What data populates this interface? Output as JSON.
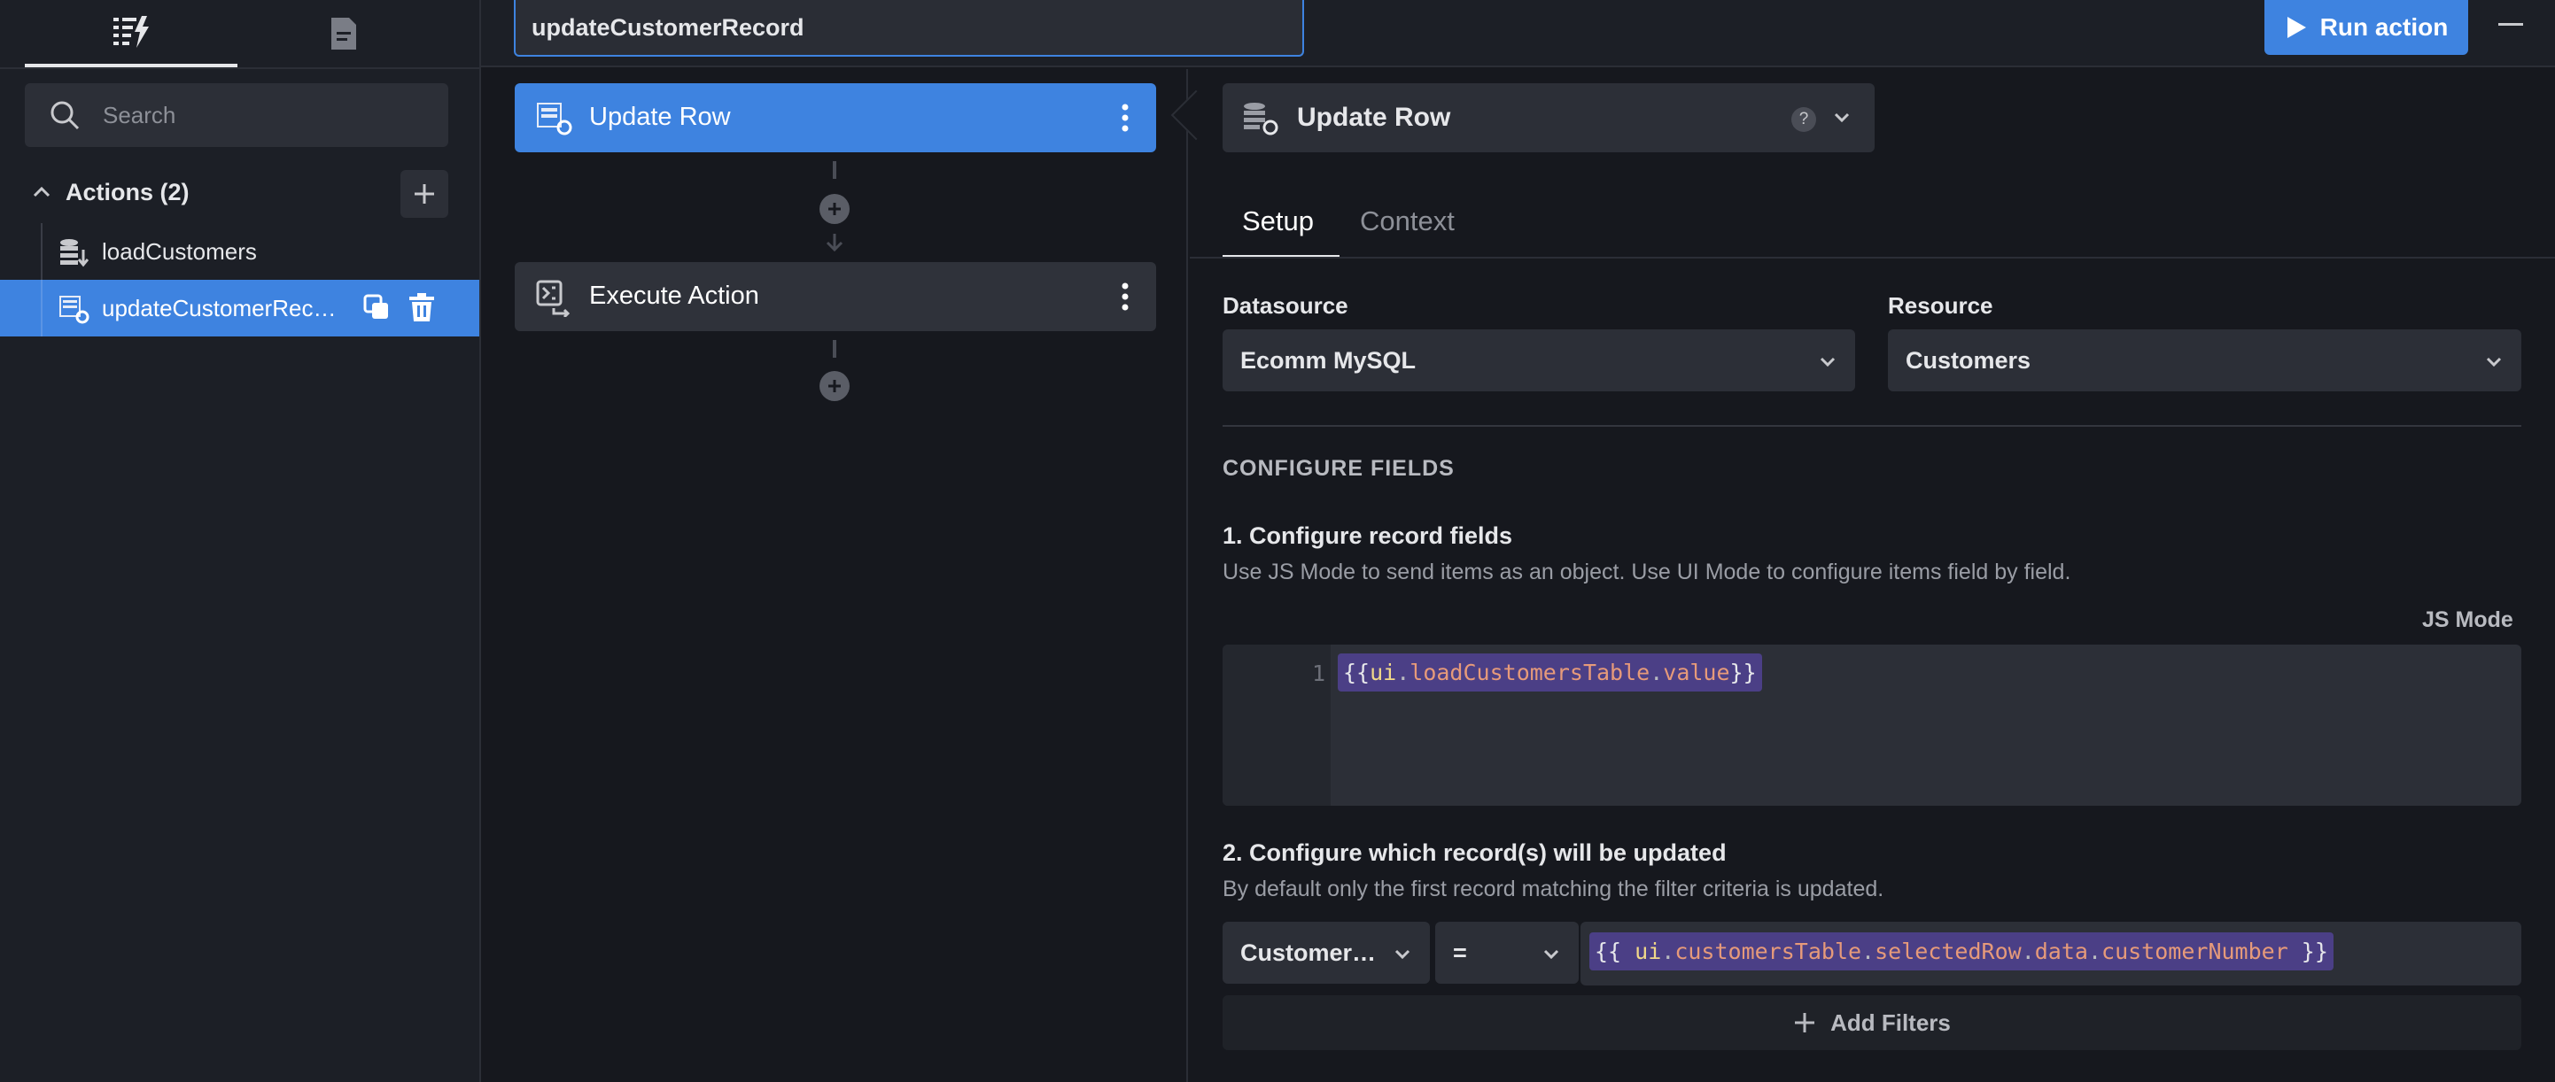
{
  "sidebar": {
    "tabs": [
      {
        "icon": "actions-lightning-icon"
      },
      {
        "icon": "document-icon"
      }
    ],
    "search_placeholder": "Search",
    "actions_header": "Actions (2)",
    "actions": [
      {
        "label": "loadCustomers",
        "icon": "database-load-icon"
      },
      {
        "label": "updateCustomerRecord",
        "icon": "database-update-icon",
        "selected": true
      }
    ]
  },
  "topbar": {
    "action_name": "updateCustomerRecord",
    "run_label": "Run action"
  },
  "flow": {
    "steps": [
      {
        "label": "Update Row",
        "icon": "database-update-icon",
        "selected": true
      },
      {
        "label": "Execute Action",
        "icon": "execute-action-icon"
      }
    ]
  },
  "panel": {
    "step_title": "Update Row",
    "help": "?",
    "tabs": [
      "Setup",
      "Context"
    ],
    "datasource_label": "Datasource",
    "datasource_value": "Ecomm MySQL",
    "resource_label": "Resource",
    "resource_value": "Customers",
    "configure_fields": "CONFIGURE FIELDS",
    "section1_title": "1. Configure record fields",
    "section1_desc": "Use JS Mode to send items as an object. Use UI Mode to configure items field by field.",
    "mode_toggle": "JS Mode",
    "code_line_number": "1",
    "code": {
      "open": "{{",
      "ui": "ui",
      "dot": ".",
      "path1": "loadCustomersTable",
      "path2": "value",
      "close": "}}"
    },
    "section2_title": "2. Configure which record(s) will be updated",
    "section2_desc": "By default only the first record matching the filter criteria is updated.",
    "filter": {
      "field": "CustomerNumber",
      "operator": "=",
      "open": "{{ ",
      "ui": "ui",
      "dot": ".",
      "p1": "customersTable",
      "p2": "selectedRow",
      "p3": "data",
      "p4": "customerNumber",
      "close": " }}"
    },
    "add_filters": "Add Filters"
  },
  "colors": {
    "accent": "#3e83e0",
    "background": "#16181e",
    "surface": "#2c2f37",
    "code_chip": "#4b3f86"
  }
}
